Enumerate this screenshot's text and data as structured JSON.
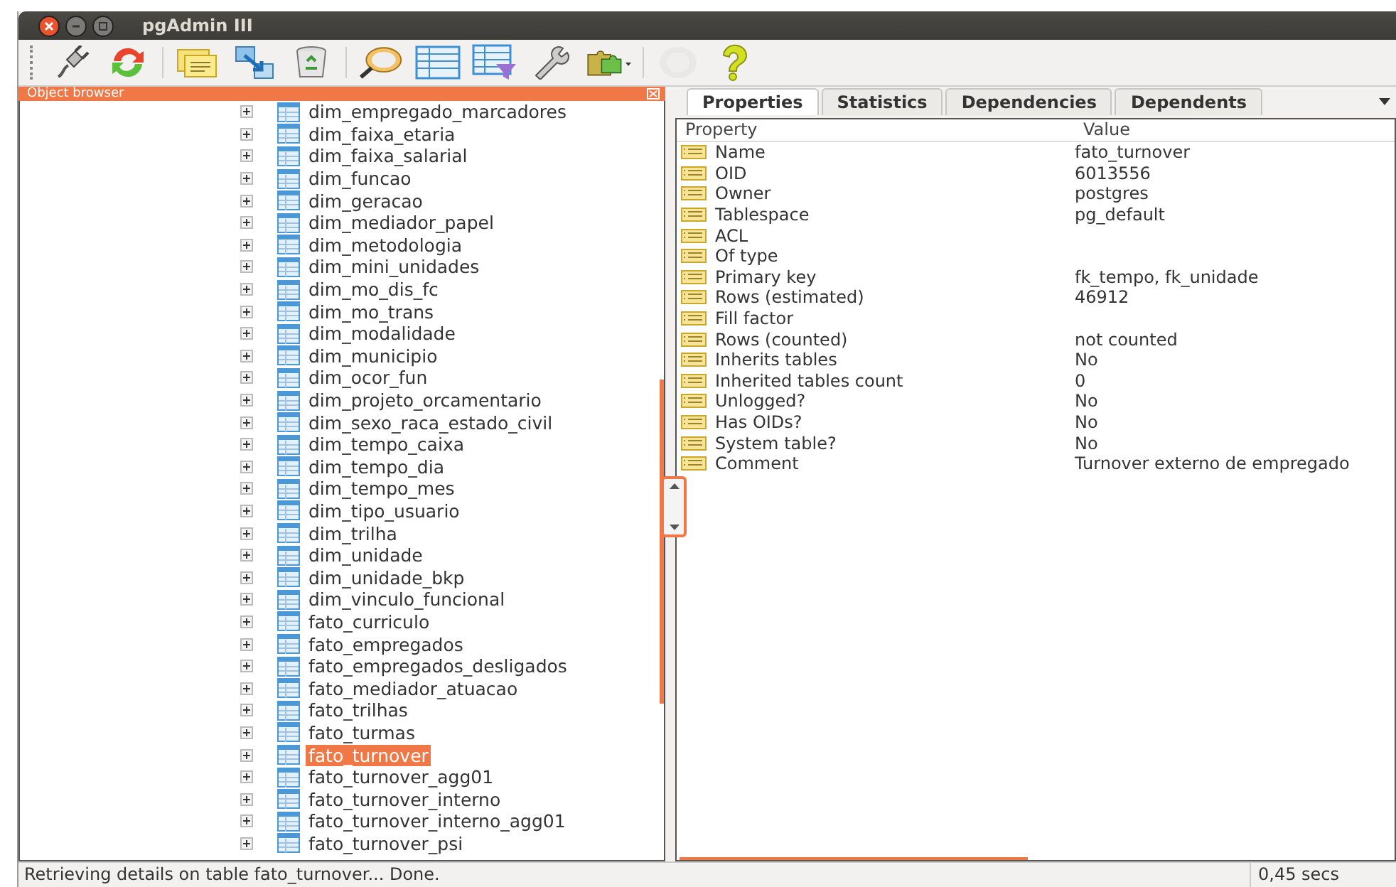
{
  "window": {
    "title": "pgAdmin III"
  },
  "toolbar": [
    {
      "disabled": false
    },
    {
      "disabled": false
    },
    {
      "disabled": false
    },
    {
      "disabled": false
    },
    {
      "disabled": false
    },
    {
      "disabled": false
    },
    {
      "disabled": false
    },
    {
      "disabled": false
    },
    {
      "disabled": false
    },
    {
      "disabled": false
    },
    {
      "disabled": true
    },
    {
      "disabled": false
    }
  ],
  "object_browser": {
    "title": "Object browser",
    "items": [
      {
        "name": "dim_empregado_marcadores",
        "selected": false
      },
      {
        "name": "dim_faixa_etaria",
        "selected": false
      },
      {
        "name": "dim_faixa_salarial",
        "selected": false
      },
      {
        "name": "dim_funcao",
        "selected": false
      },
      {
        "name": "dim_geracao",
        "selected": false
      },
      {
        "name": "dim_mediador_papel",
        "selected": false
      },
      {
        "name": "dim_metodologia",
        "selected": false
      },
      {
        "name": "dim_mini_unidades",
        "selected": false
      },
      {
        "name": "dim_mo_dis_fc",
        "selected": false
      },
      {
        "name": "dim_mo_trans",
        "selected": false
      },
      {
        "name": "dim_modalidade",
        "selected": false
      },
      {
        "name": "dim_municipio",
        "selected": false
      },
      {
        "name": "dim_ocor_fun",
        "selected": false
      },
      {
        "name": "dim_projeto_orcamentario",
        "selected": false
      },
      {
        "name": "dim_sexo_raca_estado_civil",
        "selected": false
      },
      {
        "name": "dim_tempo_caixa",
        "selected": false
      },
      {
        "name": "dim_tempo_dia",
        "selected": false
      },
      {
        "name": "dim_tempo_mes",
        "selected": false
      },
      {
        "name": "dim_tipo_usuario",
        "selected": false
      },
      {
        "name": "dim_trilha",
        "selected": false
      },
      {
        "name": "dim_unidade",
        "selected": false
      },
      {
        "name": "dim_unidade_bkp",
        "selected": false
      },
      {
        "name": "dim_vinculo_funcional",
        "selected": false
      },
      {
        "name": "fato_curriculo",
        "selected": false
      },
      {
        "name": "fato_empregados",
        "selected": false
      },
      {
        "name": "fato_empregados_desligados",
        "selected": false
      },
      {
        "name": "fato_mediador_atuacao",
        "selected": false
      },
      {
        "name": "fato_trilhas",
        "selected": false
      },
      {
        "name": "fato_turmas",
        "selected": false
      },
      {
        "name": "fato_turnover",
        "selected": true
      },
      {
        "name": "fato_turnover_agg01",
        "selected": false
      },
      {
        "name": "fato_turnover_interno",
        "selected": false
      },
      {
        "name": "fato_turnover_interno_agg01",
        "selected": false
      },
      {
        "name": "fato_turnover_psi",
        "selected": false
      }
    ]
  },
  "tabs": [
    {
      "label": "Properties",
      "selected": true
    },
    {
      "label": "Statistics",
      "selected": false
    },
    {
      "label": "Dependencies",
      "selected": false
    },
    {
      "label": "Dependents",
      "selected": false
    }
  ],
  "properties": {
    "columns": [
      "Property",
      "Value"
    ],
    "rows": [
      {
        "property": "Name",
        "value": "fato_turnover"
      },
      {
        "property": "OID",
        "value": "6013556"
      },
      {
        "property": "Owner",
        "value": "postgres"
      },
      {
        "property": "Tablespace",
        "value": "pg_default"
      },
      {
        "property": "ACL"
      },
      {
        "property": "Of type"
      },
      {
        "property": "Primary key",
        "value": "fk_tempo, fk_unidade"
      },
      {
        "property": "Rows (estimated)",
        "value": "46912"
      },
      {
        "property": "Fill factor"
      },
      {
        "property": "Rows (counted)",
        "value": "not counted"
      },
      {
        "property": "Inherits tables",
        "value": "No"
      },
      {
        "property": "Inherited tables count",
        "value": "0"
      },
      {
        "property": "Unlogged?",
        "value": "No"
      },
      {
        "property": "Has OIDs?",
        "value": "No"
      },
      {
        "property": "System table?",
        "value": "No"
      },
      {
        "property": "Comment",
        "value": "Turnover externo de empregado"
      }
    ]
  },
  "status_bar": {
    "message": "Retrieving details on table fato_turnover... Done.",
    "time": "0,45 secs"
  }
}
